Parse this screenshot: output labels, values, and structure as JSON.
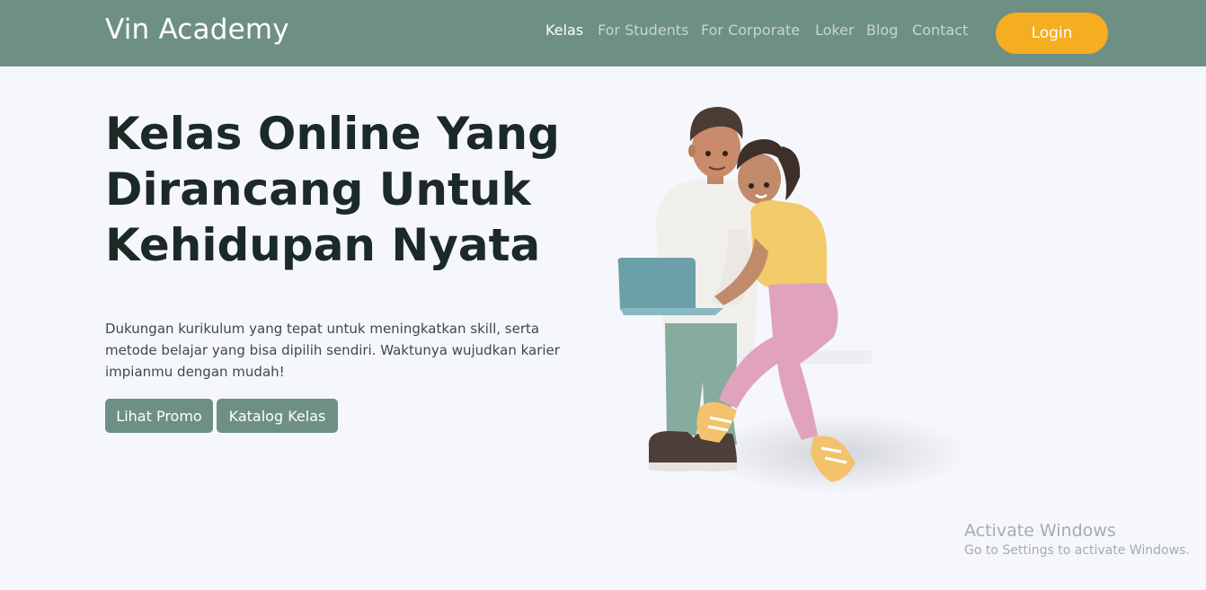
{
  "colors": {
    "nav_bg": "#6e8f84",
    "accent": "#f5ae1f",
    "button_bg": "#6e8f84",
    "page_bg": "#f6f7fc"
  },
  "navbar": {
    "brand": "Vin Academy",
    "links": [
      {
        "label": "Kelas",
        "active": true
      },
      {
        "label": "For Students",
        "active": false
      },
      {
        "label": "For Corporate",
        "active": false
      },
      {
        "label": "Loker",
        "active": false
      },
      {
        "label": "Blog",
        "active": false
      },
      {
        "label": "Contact",
        "active": false
      }
    ],
    "login_label": "Login"
  },
  "hero": {
    "title_lines": [
      "Kelas Online Yang",
      "Dirancang Untuk",
      "Kehidupan Nyata"
    ],
    "description_lines": [
      "Dukungan kurikulum yang tepat untuk meningkatkan skill, serta",
      "metode belajar yang bisa dipilih sendiri. Waktunya wujudkan karier",
      "impianmu dengan mudah!"
    ],
    "buttons": [
      "Lihat Promo",
      "Katalog Kelas"
    ],
    "illustration_icon": "students-with-laptop-illustration"
  },
  "watermark": {
    "title": "Activate Windows",
    "subtitle": "Go to Settings to activate Windows."
  }
}
